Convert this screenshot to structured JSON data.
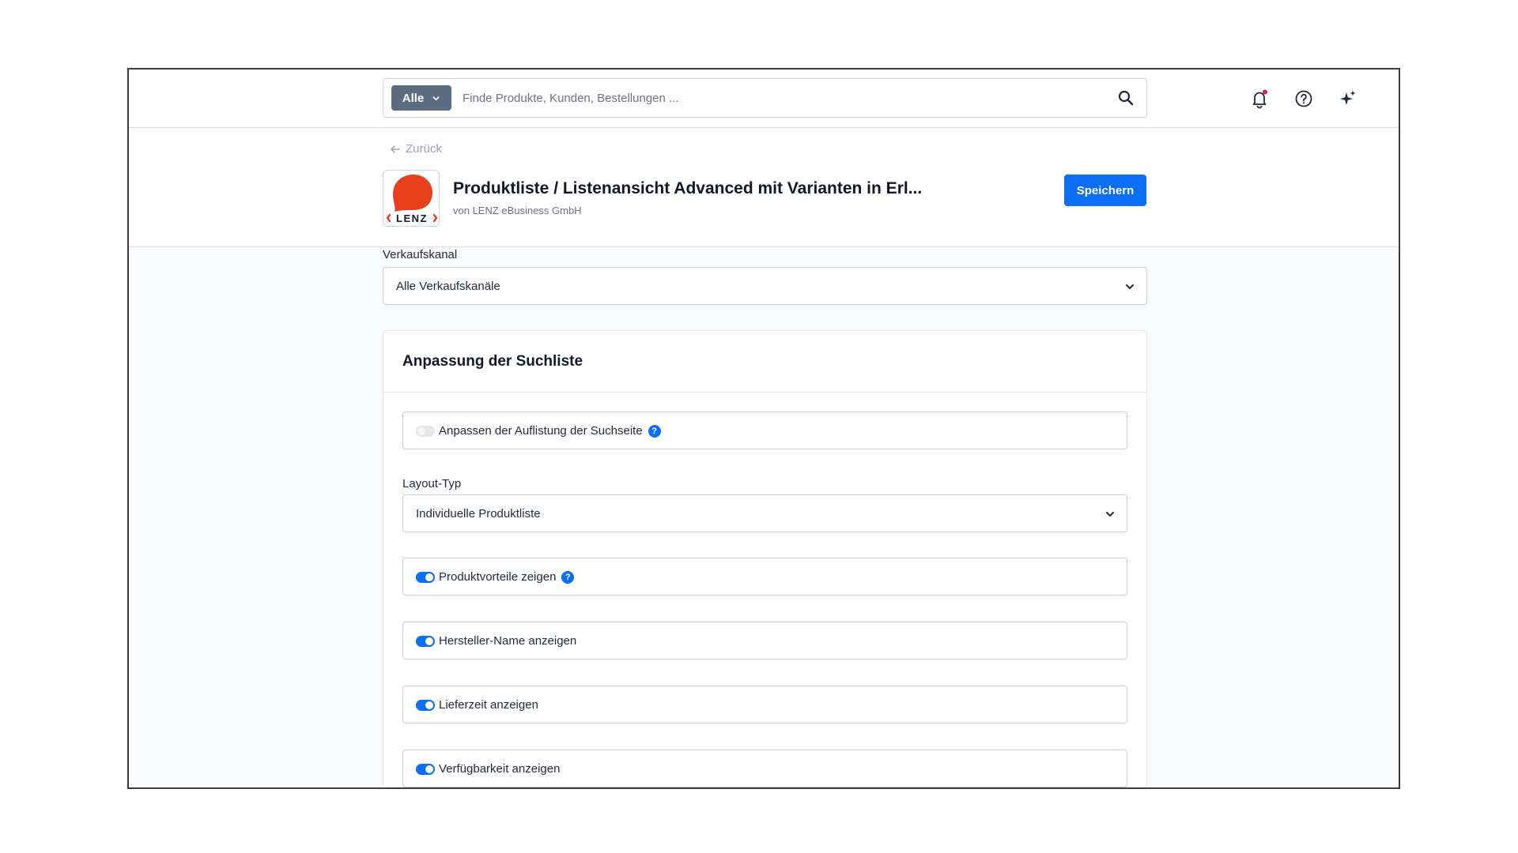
{
  "search": {
    "scope_label": "Alle",
    "placeholder": "Finde Produkte, Kunden, Bestellungen ..."
  },
  "header": {
    "back_label": "Zurück",
    "logo_text": "LENZ",
    "title": "Produktliste / Listenansicht Advanced mit Varianten in Erl...",
    "vendor": "von LENZ eBusiness GmbH",
    "save_label": "Speichern"
  },
  "sales_channel": {
    "label": "Verkaufskanal",
    "value": "Alle Verkaufskanäle"
  },
  "card": {
    "title": "Anpassung der Suchliste",
    "customize": {
      "label": "Anpassen der Auflistung der Suchseite",
      "enabled": false,
      "help": "?"
    },
    "layout": {
      "label": "Layout-Typ",
      "value": "Individuelle Produktliste"
    },
    "options": [
      {
        "label": "Produktvorteile zeigen",
        "enabled": true,
        "help": "?"
      },
      {
        "label": "Hersteller-Name anzeigen",
        "enabled": true
      },
      {
        "label": "Lieferzeit anzeigen",
        "enabled": true
      },
      {
        "label": "Verfügbarkeit anzeigen",
        "enabled": true
      }
    ]
  },
  "colors": {
    "primary": "#0b6ef5",
    "scope_bg": "#5b6b80",
    "logo_red": "#e8401c",
    "notification_dot": "#e11d48"
  },
  "icons": [
    "chevron-down-icon",
    "search-icon",
    "bell-icon",
    "help-circle-icon",
    "sparkles-icon",
    "arrow-left-icon",
    "info-icon"
  ]
}
